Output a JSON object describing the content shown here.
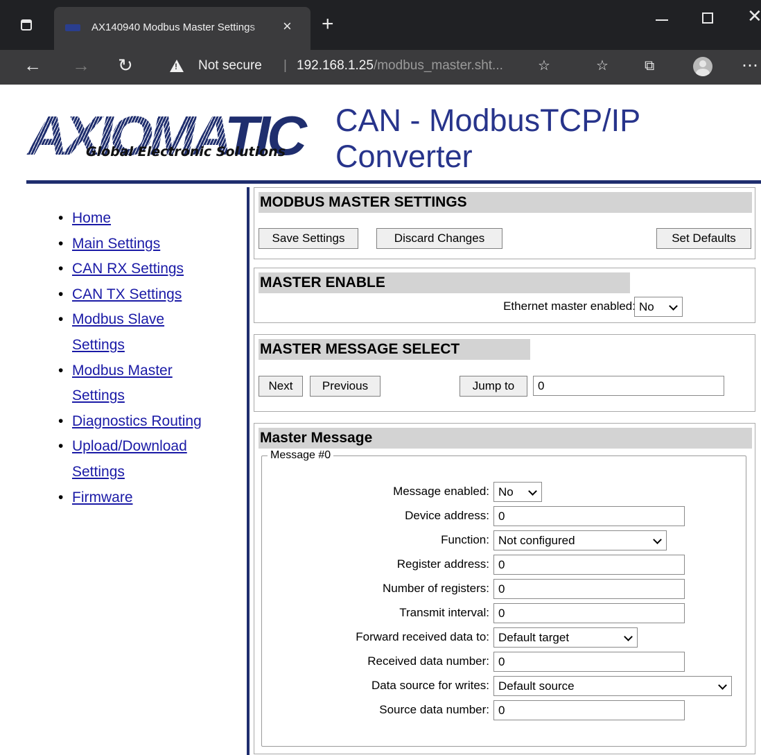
{
  "browser": {
    "tab_title": "AX140940 Modbus Master Settings",
    "close_tab_glyph": "×",
    "new_tab_glyph": "+",
    "security_label": "Not secure",
    "url_host": "192.168.1.25",
    "url_path": "/modbus_master.sht...",
    "icons": [
      "tab-actions-icon",
      "back-icon",
      "forward-icon",
      "refresh-icon",
      "warning-icon",
      "add-favorite-icon",
      "favorites-icon",
      "collections-icon",
      "profile-icon",
      "more-icon"
    ]
  },
  "header": {
    "logo_text": "AXIOMATIC",
    "logo_tagline": "Global Electronic Solutions",
    "title": "CAN - ModbusTCP/IP Converter",
    "accent_color": "#1f2e6e"
  },
  "nav": {
    "items": [
      {
        "label": "Home"
      },
      {
        "label": "Main Settings"
      },
      {
        "label": "CAN RX Settings"
      },
      {
        "label": "CAN TX Settings"
      },
      {
        "label": "Modbus Slave Settings"
      },
      {
        "label": "Modbus Master Settings"
      },
      {
        "label": "Diagnostics Routing"
      },
      {
        "label": "Upload/Download Settings"
      },
      {
        "label": "Firmware"
      }
    ]
  },
  "settings": {
    "heading": "MODBUS MASTER SETTINGS",
    "save_label": "Save Settings",
    "discard_label": "Discard Changes",
    "defaults_label": "Set Defaults"
  },
  "master_enable": {
    "heading": "MASTER ENABLE",
    "label": "Ethernet master enabled:",
    "value": "No"
  },
  "message_select": {
    "heading": "MASTER MESSAGE SELECT",
    "next_label": "Next",
    "previous_label": "Previous",
    "jump_label": "Jump to",
    "jump_value": "0"
  },
  "master_message": {
    "heading": "Master Message",
    "legend": "Message #0",
    "fields": {
      "message_enabled": {
        "label": "Message enabled:",
        "value": "No"
      },
      "device_address": {
        "label": "Device address:",
        "value": "0"
      },
      "function": {
        "label": "Function:",
        "value": "Not configured"
      },
      "register_address": {
        "label": "Register address:",
        "value": "0"
      },
      "number_of_registers": {
        "label": "Number of registers:",
        "value": "0"
      },
      "transmit_interval": {
        "label": "Transmit interval:",
        "value": "0"
      },
      "forward_received": {
        "label": "Forward received data to:",
        "value": "Default target"
      },
      "received_data_number": {
        "label": "Received data number:",
        "value": "0"
      },
      "data_source_writes": {
        "label": "Data source for writes:",
        "value": "Default source"
      },
      "source_data_number": {
        "label": "Source data number:",
        "value": "0"
      }
    }
  }
}
